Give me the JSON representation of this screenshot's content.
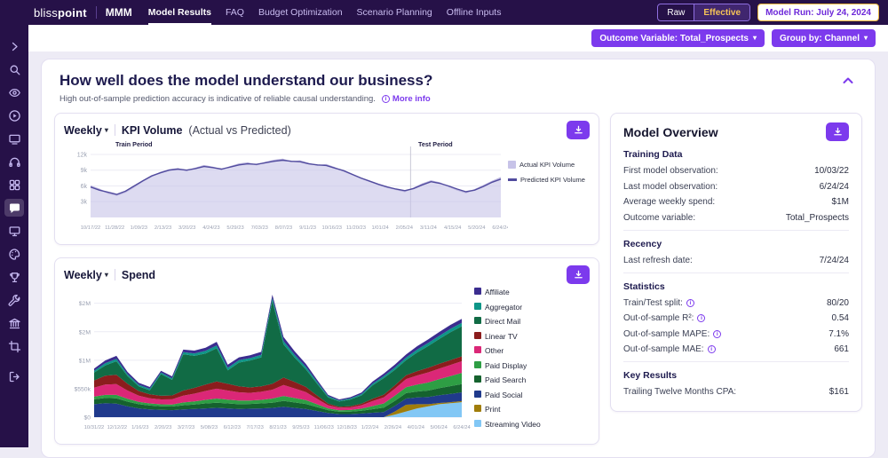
{
  "colors": {
    "accent_purple": "#7c3aed",
    "topbar_bg": "#261148",
    "page_bg": "#edebf5",
    "effective_yellow": "#f6c457",
    "heading_navy": "#1d1a4e"
  },
  "topbar": {
    "brand_light": "bliss",
    "brand_bold": "point",
    "app_label": "MMM",
    "nav": [
      {
        "label": "Model Results",
        "active": true
      },
      {
        "label": "FAQ",
        "active": false
      },
      {
        "label": "Budget Optimization",
        "active": false
      },
      {
        "label": "Scenario Planning",
        "active": false
      },
      {
        "label": "Offline Inputs",
        "active": false
      }
    ],
    "raw_label": "Raw",
    "effective_label": "Effective",
    "model_run_label": "Model Run: July 24, 2024"
  },
  "filters": {
    "outcome_label": "Outcome Variable: Total_Prospects",
    "groupby_label": "Group by: Channel"
  },
  "sidebar": {
    "icons": [
      "expand-icon",
      "search-icon",
      "eye-icon",
      "play-icon",
      "cast-icon",
      "headphones-icon",
      "grid-icon",
      "chat-icon",
      "monitor-icon",
      "palette-icon",
      "trophy-icon",
      "wrench-icon",
      "library-icon",
      "crop-icon",
      "logout-icon"
    ]
  },
  "header": {
    "title": "How well does the model understand our business?",
    "subtitle": "High out-of-sample prediction accuracy is indicative of reliable causal understanding.",
    "more_info": "More info"
  },
  "kpi_card": {
    "freq_label": "Weekly",
    "title": "KPI Volume",
    "subtitle": "(Actual vs Predicted)",
    "train_label": "Train Period",
    "test_label": "Test Period"
  },
  "spend_card": {
    "freq_label": "Weekly",
    "title": "Spend"
  },
  "model_overview": {
    "title": "Model Overview",
    "sections": [
      {
        "title": "Training Data",
        "rows": [
          {
            "label": "First model observation:",
            "value": "10/03/22"
          },
          {
            "label": "Last model observation:",
            "value": "6/24/24"
          },
          {
            "label": "Average weekly spend:",
            "value": "$1M"
          },
          {
            "label": "Outcome variable:",
            "value": "Total_Prospects"
          }
        ]
      },
      {
        "title": "Recency",
        "rows": [
          {
            "label": "Last refresh date:",
            "value": "7/24/24"
          }
        ]
      },
      {
        "title": "Statistics",
        "rows": [
          {
            "label": "Train/Test split:",
            "info": true,
            "value": "80/20"
          },
          {
            "label": "Out-of-sample R²:",
            "info": true,
            "value": "0.54"
          },
          {
            "label": "Out-of-sample MAPE:",
            "info": true,
            "value": "7.1%"
          },
          {
            "label": "Out-of-sample MAE:",
            "info": true,
            "value": "661"
          }
        ]
      },
      {
        "title": "Key Results",
        "rows": [
          {
            "label": "Trailing Twelve Months CPA:",
            "value": "$161"
          }
        ]
      }
    ]
  },
  "chart_data": [
    {
      "type": "line",
      "title": "Weekly KPI Volume (Actual vs Predicted)",
      "unit": "thousands of KPI volume per week",
      "ylim": [
        0,
        12.5
      ],
      "split_fraction": 0.78,
      "grid": true,
      "legend_position": "right",
      "y_ticks": [
        {
          "v": 3,
          "label": "3k"
        },
        {
          "v": 6,
          "label": "6k"
        },
        {
          "v": 9,
          "label": "9k"
        },
        {
          "v": 12,
          "label": "12k"
        }
      ],
      "x_ticks": [
        "10/17/22",
        "11/28/22",
        "1/09/23",
        "2/13/23",
        "3/20/23",
        "4/24/23",
        "5/29/23",
        "7/03/23",
        "8/07/23",
        "9/11/23",
        "10/16/23",
        "11/20/23",
        "1/01/24",
        "2/05/24",
        "3/11/24",
        "4/15/24",
        "5/20/24",
        "6/24/24"
      ],
      "series": [
        {
          "name": "Actual KPI Volume",
          "style": "area",
          "color": "#c7c3e8",
          "values": [
            6.0,
            5.4,
            4.6,
            4.2,
            4.8,
            5.8,
            6.9,
            7.8,
            8.6,
            9.1,
            9.3,
            8.9,
            9.4,
            9.9,
            9.6,
            9.1,
            9.7,
            10.2,
            10.4,
            10.0,
            10.5,
            10.9,
            11.1,
            10.6,
            10.8,
            10.3,
            9.9,
            10.1,
            9.5,
            8.8,
            8.1,
            7.4,
            6.8,
            6.2,
            5.7,
            5.3,
            4.9,
            5.6,
            6.4,
            7.0,
            6.6,
            5.9,
            5.2,
            4.7,
            5.3,
            6.1,
            6.9,
            7.6
          ]
        },
        {
          "name": "Predicted KPI Volume",
          "style": "line",
          "color": "#514b9e",
          "values": [
            5.8,
            5.2,
            4.8,
            4.4,
            5.0,
            6.0,
            7.0,
            7.9,
            8.5,
            9.0,
            9.2,
            9.0,
            9.3,
            9.7,
            9.5,
            9.2,
            9.6,
            10.0,
            10.2,
            10.1,
            10.4,
            10.7,
            10.9,
            10.7,
            10.6,
            10.2,
            10.0,
            9.9,
            9.4,
            8.9,
            8.2,
            7.5,
            6.9,
            6.3,
            5.8,
            5.4,
            5.1,
            5.5,
            6.2,
            6.8,
            6.5,
            6.0,
            5.4,
            4.9,
            5.2,
            5.9,
            6.7,
            7.3
          ]
        }
      ]
    },
    {
      "type": "area",
      "title": "Weekly Spend",
      "unit": "$ thousands per week",
      "ylim": [
        0,
        2400
      ],
      "grid": true,
      "legend_position": "right",
      "y_ticks": [
        {
          "v": 0,
          "label": "$0"
        },
        {
          "v": 550,
          "label": "$550k"
        },
        {
          "v": 1100,
          "label": "$1M"
        },
        {
          "v": 1650,
          "label": "$2M"
        },
        {
          "v": 2200,
          "label": "$2M"
        }
      ],
      "x_ticks": [
        "10/31/22",
        "12/12/22",
        "1/16/23",
        "2/20/23",
        "3/27/23",
        "5/08/23",
        "6/12/23",
        "7/17/23",
        "8/21/23",
        "9/25/23",
        "11/06/23",
        "12/18/23",
        "1/22/24",
        "2/26/24",
        "4/01/24",
        "5/06/24",
        "6/24/24"
      ],
      "stack_bottom_to_top": [
        "Streaming Video",
        "Print",
        "Paid Social",
        "Paid Search",
        "Paid Display",
        "Other",
        "Linear TV",
        "Direct Mail",
        "Aggregator",
        "Affiliate"
      ],
      "series": [
        {
          "name": "Affiliate",
          "color": "#3b2d8f",
          "values": [
            45,
            55,
            60,
            45,
            38,
            35,
            35,
            38,
            50,
            55,
            60,
            70,
            60,
            55,
            55,
            58,
            65,
            80,
            68,
            58,
            42,
            26,
            22,
            24,
            30,
            40,
            48,
            55,
            60,
            66,
            70,
            74,
            76,
            78
          ]
        },
        {
          "name": "Aggregator",
          "color": "#0e9688",
          "values": [
            35,
            40,
            45,
            35,
            30,
            28,
            28,
            30,
            40,
            45,
            50,
            55,
            48,
            45,
            45,
            48,
            55,
            65,
            55,
            48,
            35,
            22,
            18,
            20,
            25,
            32,
            38,
            45,
            50,
            55,
            60,
            62,
            64,
            66
          ]
        },
        {
          "name": "Direct Mail",
          "color": "#116b45",
          "values": [
            150,
            200,
            260,
            150,
            90,
            80,
            420,
            300,
            700,
            620,
            600,
            640,
            260,
            460,
            520,
            560,
            1600,
            640,
            470,
            340,
            230,
            120,
            100,
            130,
            160,
            260,
            320,
            300,
            290,
            360,
            420,
            480,
            540,
            580
          ]
        },
        {
          "name": "Linear TV",
          "color": "#8b1d1d",
          "values": [
            140,
            170,
            180,
            130,
            90,
            75,
            70,
            75,
            100,
            110,
            125,
            140,
            130,
            115,
            105,
            105,
            115,
            145,
            125,
            100,
            65,
            32,
            22,
            24,
            30,
            45,
            55,
            65,
            75,
            85,
            90,
            92,
            94,
            95
          ]
        },
        {
          "name": "Other",
          "color": "#db2777",
          "values": [
            170,
            200,
            210,
            160,
            120,
            100,
            95,
            100,
            130,
            150,
            170,
            190,
            175,
            160,
            150,
            155,
            170,
            210,
            185,
            155,
            105,
            60,
            48,
            50,
            65,
            95,
            115,
            135,
            155,
            175,
            195,
            205,
            215,
            225
          ]
        },
        {
          "name": "Paid Display",
          "color": "#2e9e44",
          "values": [
            55,
            60,
            65,
            55,
            45,
            40,
            38,
            40,
            55,
            60,
            70,
            80,
            75,
            70,
            65,
            70,
            80,
            95,
            85,
            75,
            55,
            35,
            28,
            30,
            40,
            60,
            80,
            100,
            115,
            135,
            155,
            175,
            195,
            215
          ]
        },
        {
          "name": "Paid Search",
          "color": "#15622e",
          "values": [
            95,
            100,
            105,
            90,
            80,
            75,
            70,
            70,
            80,
            85,
            95,
            100,
            95,
            90,
            90,
            95,
            100,
            115,
            105,
            95,
            75,
            55,
            45,
            48,
            55,
            70,
            85,
            95,
            105,
            115,
            125,
            135,
            150,
            160
          ]
        },
        {
          "name": "Paid Social",
          "color": "#203a8c",
          "values": [
            250,
            270,
            260,
            210,
            170,
            150,
            140,
            135,
            150,
            160,
            170,
            180,
            170,
            160,
            165,
            170,
            180,
            200,
            180,
            160,
            120,
            80,
            60,
            60,
            70,
            85,
            100,
            110,
            120,
            130,
            140,
            150,
            160,
            170
          ]
        },
        {
          "name": "Print",
          "color": "#a07d0a",
          "values": [
            0,
            0,
            0,
            0,
            0,
            0,
            0,
            0,
            0,
            0,
            0,
            0,
            0,
            0,
            0,
            0,
            0,
            0,
            0,
            0,
            0,
            0,
            0,
            0,
            0,
            0,
            0,
            60,
            130,
            80,
            40,
            25,
            20,
            20
          ]
        },
        {
          "name": "Streaming Video",
          "color": "#82c7f5",
          "values": [
            0,
            0,
            0,
            0,
            0,
            0,
            0,
            0,
            0,
            0,
            0,
            0,
            0,
            0,
            0,
            0,
            0,
            0,
            0,
            0,
            0,
            0,
            0,
            0,
            0,
            0,
            0,
            50,
            110,
            170,
            210,
            250,
            270,
            290
          ]
        }
      ]
    }
  ]
}
